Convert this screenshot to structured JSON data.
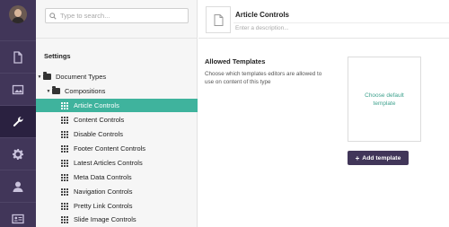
{
  "search": {
    "placeholder": "Type to search..."
  },
  "tree": {
    "header": "Settings",
    "root": "Document Types",
    "folder": "Compositions",
    "items": [
      {
        "label": "Article Controls",
        "selected": true
      },
      {
        "label": "Content Controls"
      },
      {
        "label": "Disable Controls"
      },
      {
        "label": "Footer Content Controls"
      },
      {
        "label": "Latest Articles Controls"
      },
      {
        "label": "Meta Data Controls"
      },
      {
        "label": "Navigation Controls"
      },
      {
        "label": "Pretty Link Controls"
      },
      {
        "label": "Slide Image Controls"
      }
    ]
  },
  "editor": {
    "name": "Article Controls",
    "description_placeholder": "Enter a description...",
    "allowed_templates_title": "Allowed Templates",
    "allowed_templates_desc": "Choose which templates editors are allowed to use on content of this type",
    "default_template_label": "Choose default template",
    "add_template_label": "Add template",
    "add_template_icon": "+"
  },
  "colors": {
    "sections_bg": "#413659",
    "selected": "#3fb39d",
    "link": "#3fa28e"
  },
  "sections": [
    "avatar",
    "content-icon",
    "media-icon",
    "settings-wrench-icon",
    "developer-gear-icon",
    "users-icon",
    "members-icon"
  ]
}
